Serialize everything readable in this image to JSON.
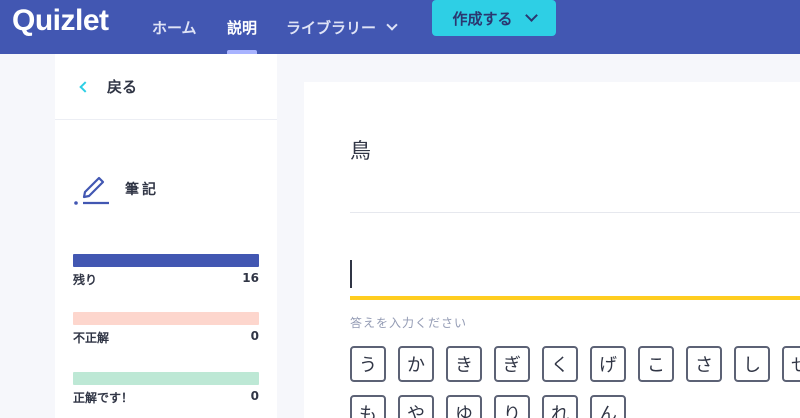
{
  "header": {
    "logo": "Quizlet",
    "nav": {
      "home": "ホーム",
      "explain": "説明",
      "library": "ライブラリー"
    },
    "create_label": "作成する"
  },
  "sidebar": {
    "back_label": "戻る",
    "mode_label": "筆記",
    "progress": [
      {
        "label": "残り",
        "count": "16",
        "color": "#4257b2"
      },
      {
        "label": "不正解",
        "count": "0",
        "color": "#fdd6cd"
      },
      {
        "label": "正解です！",
        "count": "0",
        "color": "#bde8d5"
      }
    ]
  },
  "main": {
    "term": "鳥",
    "answer_value": "",
    "hint": "答えを入力ください",
    "keyboard": {
      "row1": [
        "う",
        "か",
        "き",
        "ぎ",
        "く",
        "げ",
        "こ",
        "さ",
        "し",
        "せ"
      ],
      "row2": [
        "も",
        "や",
        "ゆ",
        "り",
        "れ",
        "ん"
      ]
    }
  },
  "colors": {
    "brand": "#4257b2",
    "accent": "#2ecfe5",
    "underline": "#ffcd1f"
  }
}
